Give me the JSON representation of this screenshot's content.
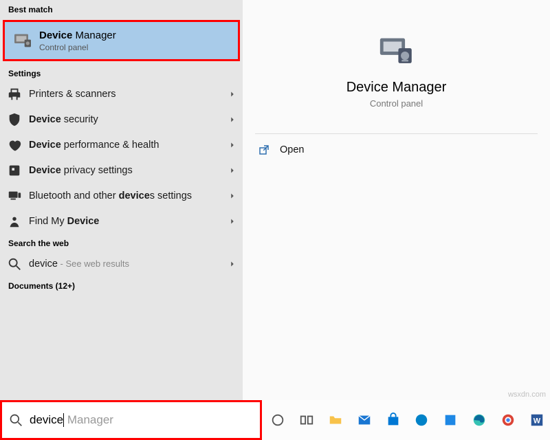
{
  "left": {
    "best_match_header": "Best match",
    "best_match": {
      "title_bold": "Device",
      "title_rest": " Manager",
      "sub": "Control panel"
    },
    "settings_header": "Settings",
    "settings": [
      {
        "icon": "printer-icon",
        "pre": "",
        "bold": "",
        "label": "Printers & scanners"
      },
      {
        "icon": "shield-icon",
        "pre": "",
        "bold": "Device",
        "label": " security"
      },
      {
        "icon": "heart-icon",
        "pre": "",
        "bold": "Device",
        "label": " performance & health"
      },
      {
        "icon": "privacy-icon",
        "pre": "",
        "bold": "Device",
        "label": " privacy settings"
      },
      {
        "icon": "bluetooth-icon",
        "pre": "Bluetooth and other ",
        "bold": "device",
        "label": "s settings"
      },
      {
        "icon": "find-icon",
        "pre": "Find My ",
        "bold": "Device",
        "label": ""
      }
    ],
    "web_header": "Search the web",
    "web": {
      "term": "device",
      "suffix": " - See web results"
    },
    "docs_header": "Documents (12+)"
  },
  "right": {
    "title": "Device Manager",
    "sub": "Control panel",
    "open": "Open"
  },
  "search": {
    "typed": "device",
    "ghost": " Manager"
  },
  "watermark": "wsxdn.com"
}
